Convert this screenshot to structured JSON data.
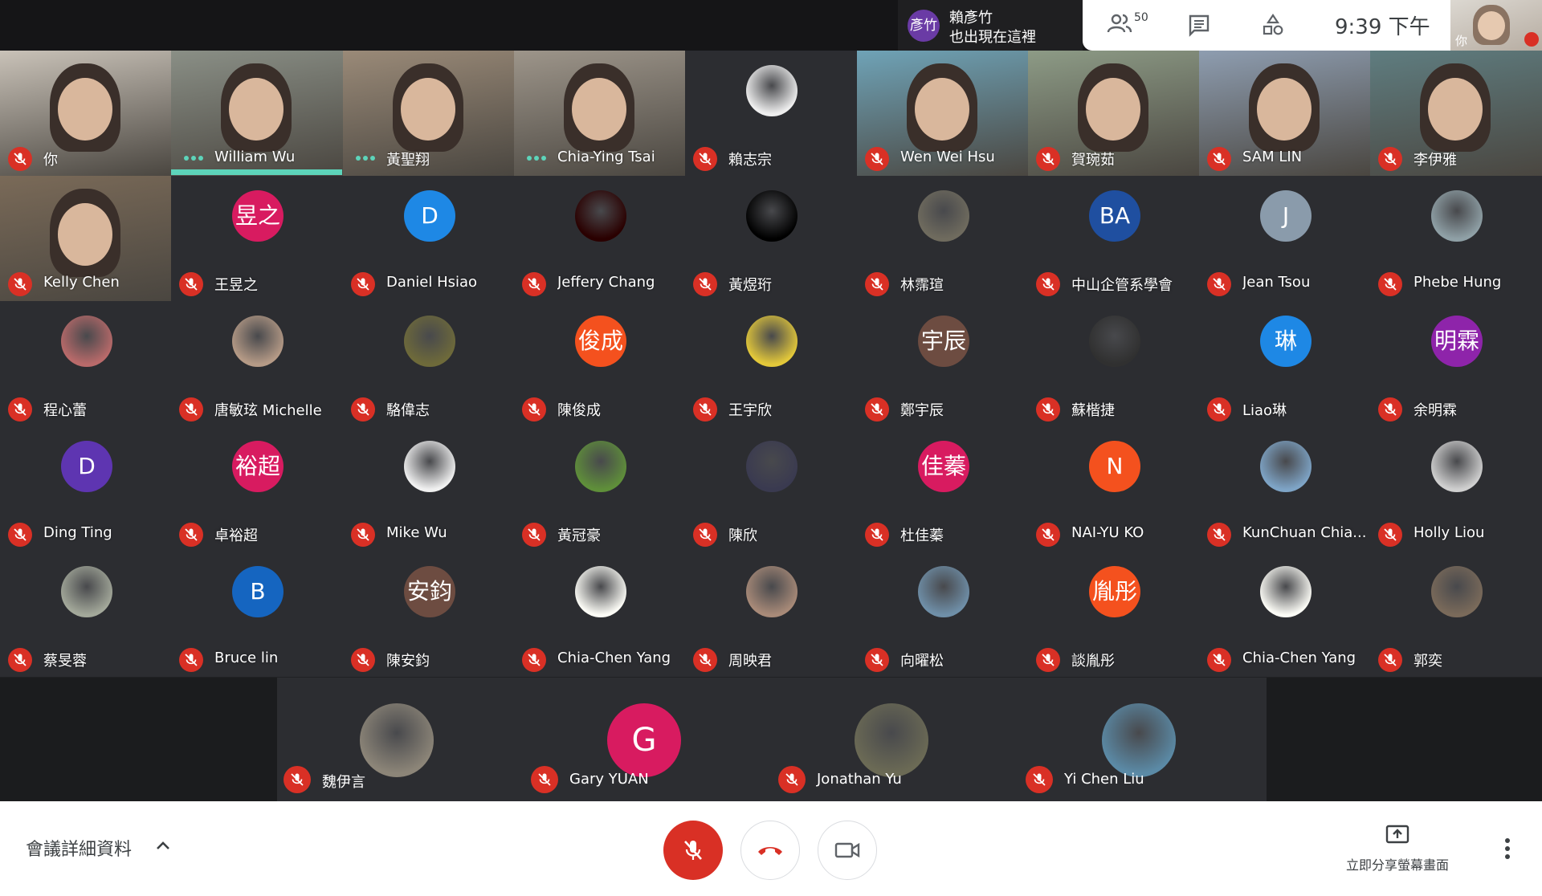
{
  "notification": {
    "avatar_text": "彥竹",
    "name": "賴彥竹",
    "message": "也出現在這裡"
  },
  "header": {
    "participant_count": "50",
    "time": "9:39 下午",
    "self_thumb_label": "你"
  },
  "tiles": [
    {
      "name": "你",
      "avatar": "",
      "color": "#c9c2b8",
      "state": "mic-off",
      "video": true
    },
    {
      "name": "William Wu",
      "avatar": "",
      "color": "#8a8f86",
      "state": "speaking",
      "video": true
    },
    {
      "name": "黃聖翔",
      "avatar": "",
      "color": "#9a8a78",
      "state": "speaking",
      "video": true
    },
    {
      "name": "Chia-Ying Tsai",
      "avatar": "",
      "color": "#9d958a",
      "state": "speaking",
      "video": true
    },
    {
      "name": "賴志宗",
      "avatar": "",
      "color": "#eeeeee",
      "state": "mic-off",
      "video": false,
      "photo": true
    },
    {
      "name": "Wen Wei Hsu",
      "avatar": "",
      "color": "#6fa3b7",
      "state": "mic-off",
      "video": true
    },
    {
      "name": "賀琬茹",
      "avatar": "",
      "color": "#8d9b86",
      "state": "mic-off",
      "video": true
    },
    {
      "name": "SAM LIN",
      "avatar": "",
      "color": "#8e9db0",
      "state": "mic-off",
      "video": true
    },
    {
      "name": "李伊雅",
      "avatar": "",
      "color": "#5f7d80",
      "state": "mic-off",
      "video": true
    },
    {
      "name": "Kelly Chen",
      "avatar": "",
      "color": "#7a6a58",
      "state": "mic-off",
      "video": true
    },
    {
      "name": "王昱之",
      "avatar": "昱之",
      "color": "#d81b60",
      "state": "mic-off"
    },
    {
      "name": "Daniel Hsiao",
      "avatar": "D",
      "color": "#1e88e5",
      "state": "mic-off"
    },
    {
      "name": "Jeffery Chang",
      "avatar": "",
      "color": "#2a0000",
      "state": "mic-off",
      "photo": true
    },
    {
      "name": "黃煜珩",
      "avatar": "",
      "color": "#000000",
      "state": "mic-off",
      "photo": true
    },
    {
      "name": "林霈瑄",
      "avatar": "",
      "color": "#6f6b5e",
      "state": "mic-off",
      "photo": true
    },
    {
      "name": "中山企管系學會",
      "avatar": "BA",
      "color": "#1f4fa0",
      "state": "mic-off"
    },
    {
      "name": "Jean Tsou",
      "avatar": "J",
      "color": "#8a9bab",
      "state": "mic-off"
    },
    {
      "name": "Phebe Hung",
      "avatar": "",
      "color": "#8fa0a6",
      "state": "mic-off",
      "photo": true
    },
    {
      "name": "程心蕾",
      "avatar": "",
      "color": "#b96a6a",
      "state": "mic-off",
      "photo": true
    },
    {
      "name": "唐敏玹 Michelle",
      "avatar": "",
      "color": "#b59a86",
      "state": "mic-off",
      "photo": true
    },
    {
      "name": "駱偉志",
      "avatar": "",
      "color": "#6e6a3a",
      "state": "mic-off",
      "photo": true
    },
    {
      "name": "陳俊成",
      "avatar": "俊成",
      "color": "#f4511e",
      "state": "mic-off"
    },
    {
      "name": "王宇欣",
      "avatar": "",
      "color": "#e3c83a",
      "state": "mic-off",
      "photo": true
    },
    {
      "name": "鄭宇辰",
      "avatar": "宇辰",
      "color": "#6d4c41",
      "state": "mic-off"
    },
    {
      "name": "蘇楷捷",
      "avatar": "",
      "color": "#303030",
      "state": "mic-off",
      "photo": true
    },
    {
      "name": "Liao琳",
      "avatar": "琳",
      "color": "#1e88e5",
      "state": "mic-off"
    },
    {
      "name": "余明霖",
      "avatar": "明霖",
      "color": "#8e24aa",
      "state": "mic-off"
    },
    {
      "name": "Ding Ting",
      "avatar": "D",
      "color": "#5e35b1",
      "state": "mic-off"
    },
    {
      "name": "卓裕超",
      "avatar": "裕超",
      "color": "#d81b60",
      "state": "mic-off"
    },
    {
      "name": "Mike Wu",
      "avatar": "",
      "color": "#f0f0f0",
      "state": "mic-off",
      "photo": true
    },
    {
      "name": "黃冠豪",
      "avatar": "",
      "color": "#5f8f3a",
      "state": "mic-off",
      "photo": true
    },
    {
      "name": "陳欣",
      "avatar": "",
      "color": "#3a3a50",
      "state": "mic-off",
      "photo": true
    },
    {
      "name": "杜佳蓁",
      "avatar": "佳蓁",
      "color": "#d81b60",
      "state": "mic-off"
    },
    {
      "name": "NAI-YU KO",
      "avatar": "N",
      "color": "#f4511e",
      "state": "mic-off"
    },
    {
      "name": "KunChuan Chia...",
      "avatar": "",
      "color": "#7ea4c6",
      "state": "mic-off",
      "photo": true
    },
    {
      "name": "Holly Liou",
      "avatar": "",
      "color": "#cfcfcf",
      "state": "mic-off",
      "photo": true
    },
    {
      "name": "蔡旻蓉",
      "avatar": "",
      "color": "#a3a89a",
      "state": "mic-off",
      "photo": true
    },
    {
      "name": "Bruce lin",
      "avatar": "B",
      "color": "#1565c0",
      "state": "mic-off"
    },
    {
      "name": "陳安鈞",
      "avatar": "安鈞",
      "color": "#6d4c41",
      "state": "mic-off"
    },
    {
      "name": "Chia-Chen Yang",
      "avatar": "",
      "color": "#fbfbf5",
      "state": "mic-off",
      "photo": true
    },
    {
      "name": "周映君",
      "avatar": "",
      "color": "#a88a78",
      "state": "mic-off",
      "photo": true
    },
    {
      "name": "向曜松",
      "avatar": "",
      "color": "#6f8fa8",
      "state": "mic-off",
      "photo": true
    },
    {
      "name": "談胤彤",
      "avatar": "胤彤",
      "color": "#f4511e",
      "state": "mic-off"
    },
    {
      "name": "Chia-Chen Yang",
      "avatar": "",
      "color": "#fbfbf5",
      "state": "mic-off",
      "photo": true
    },
    {
      "name": "郭奕",
      "avatar": "",
      "color": "#7a6a5a",
      "state": "mic-off",
      "photo": true
    }
  ],
  "bottom_row": [
    {
      "name": "魏伊言",
      "avatar": "",
      "color": "#8c8578",
      "photo": true
    },
    {
      "name": "Gary YUAN",
      "avatar": "G",
      "color": "#d81b60"
    },
    {
      "name": "Jonathan Yu",
      "avatar": "",
      "color": "#6b6a55",
      "photo": true
    },
    {
      "name": "Yi Chen Liu",
      "avatar": "",
      "color": "#5b8aa6",
      "photo": true
    }
  ],
  "footer": {
    "details_label": "會議詳細資料",
    "present_label": "立即分享螢幕畫面"
  },
  "colors": {
    "mute_red": "#d93025",
    "speak_teal": "#5dd4ba",
    "tile_bg": "#2c2d31"
  }
}
